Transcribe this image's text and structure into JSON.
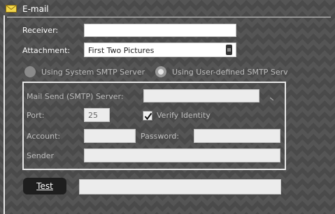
{
  "section": {
    "title": "E-mail"
  },
  "receiver": {
    "label": "Receiver:",
    "value": ""
  },
  "attachment": {
    "label": "Attachment:",
    "value": "First Two Pictures"
  },
  "smtp_mode": {
    "system": "Using System SMTP Server",
    "user": "Using User-defined SMTP Serv",
    "selected": "user"
  },
  "smtp": {
    "server_label": "Mail Send (SMTP) Server:",
    "server_value": "",
    "port_label": "Port:",
    "port_value": "25",
    "verify_label": "Verify Identity",
    "verify_checked": true,
    "account_label": "Account:",
    "account_value": "",
    "password_label": "Password:",
    "password_value": "",
    "sender_label": "Sender",
    "sender_value": ""
  },
  "test": {
    "label": "Test",
    "result": ""
  }
}
